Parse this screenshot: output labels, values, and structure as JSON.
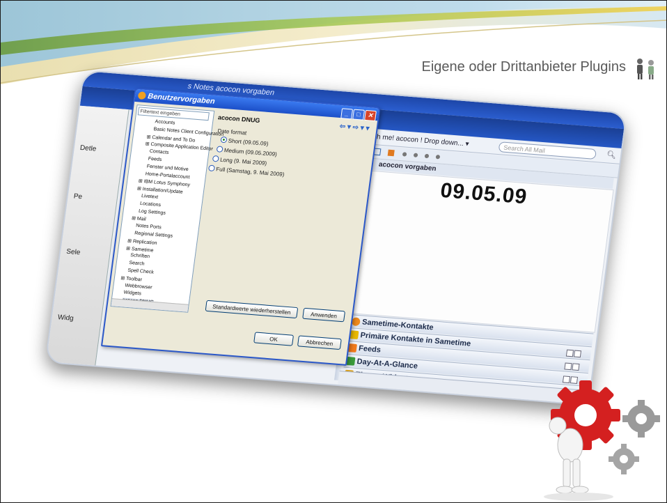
{
  "slide": {
    "title": "Eigene oder Drittanbieter Plugins"
  },
  "app": {
    "window_title": "s Notes acocon vorgaben",
    "left_strip": [
      "Detle",
      "Pe",
      "Sele",
      "Widg"
    ],
    "toolbar": {
      "links": "sh me!  acocon ! Drop down...  ▾",
      "search_placeholder": "Search All Mail"
    },
    "panel": {
      "title": "acocon vorgaben",
      "date_value": "09.05.09"
    },
    "sidebar_rows": [
      {
        "label": "Sametime-Kontakte",
        "color": "#f08a1c"
      },
      {
        "label": "Primäre Kontakte in Sametime",
        "color": "#e8b800"
      },
      {
        "label": "Feeds",
        "color": "#f07a1c"
      },
      {
        "label": "Day-At-A-Glance",
        "color": "#3a9a3a"
      },
      {
        "label": "Eigene Widgets",
        "color": "#d9a020"
      }
    ]
  },
  "dialog": {
    "title": "Benutzervorgaben",
    "filter_placeholder": "Filtertext eingeben",
    "tree_items": [
      {
        "label": "Accounts",
        "indent": 2,
        "expander": false
      },
      {
        "label": "Basic Notes Client Configuration",
        "indent": 2,
        "expander": false
      },
      {
        "label": "Calendar and To Do",
        "indent": 1,
        "expander": true
      },
      {
        "label": "Composite Application Editor",
        "indent": 1,
        "expander": true
      },
      {
        "label": "Contacts",
        "indent": 2,
        "expander": false
      },
      {
        "label": "Feeds",
        "indent": 2,
        "expander": false
      },
      {
        "label": "Fenster und Motive",
        "indent": 2,
        "expander": false
      },
      {
        "label": "Home-Portalaccount",
        "indent": 2,
        "expander": false
      },
      {
        "label": "IBM Lotus Symphony",
        "indent": 1,
        "expander": true
      },
      {
        "label": "Installation/Update",
        "indent": 1,
        "expander": true
      },
      {
        "label": "Livetext",
        "indent": 2,
        "expander": false
      },
      {
        "label": "Locations",
        "indent": 2,
        "expander": false
      },
      {
        "label": "Log Settings",
        "indent": 2,
        "expander": false
      },
      {
        "label": "Mail",
        "indent": 1,
        "expander": true
      },
      {
        "label": "Notes Ports",
        "indent": 2,
        "expander": false
      },
      {
        "label": "Regional Settings",
        "indent": 2,
        "expander": false
      },
      {
        "label": "Replication",
        "indent": 1,
        "expander": true
      },
      {
        "label": "Sametime",
        "indent": 1,
        "expander": true
      },
      {
        "label": "Schriften",
        "indent": 2,
        "expander": false
      },
      {
        "label": "Search",
        "indent": 2,
        "expander": false
      },
      {
        "label": "Spell Check",
        "indent": 2,
        "expander": false
      },
      {
        "label": "Toolbar",
        "indent": 1,
        "expander": true
      },
      {
        "label": "Webbrowser",
        "indent": 2,
        "expander": false
      },
      {
        "label": "Widgets",
        "indent": 2,
        "expander": false
      },
      {
        "label": "acocon DNUG",
        "indent": 2,
        "expander": false,
        "selected": true
      }
    ],
    "page_title": "acocon DNUG",
    "date_format_label": "Date format",
    "options": [
      {
        "label": "Short (09.05.09)",
        "checked": true
      },
      {
        "label": "Medium (09.05.2009)",
        "checked": false
      },
      {
        "label": "Long (9. Mai 2009)",
        "checked": false
      },
      {
        "label": "Full (Samstag, 9. Mai 2009)",
        "checked": false
      }
    ],
    "buttons": {
      "restore_defaults": "Standardwerte wiederherstellen",
      "apply": "Anwenden",
      "ok": "OK",
      "cancel": "Abbrechen"
    }
  }
}
